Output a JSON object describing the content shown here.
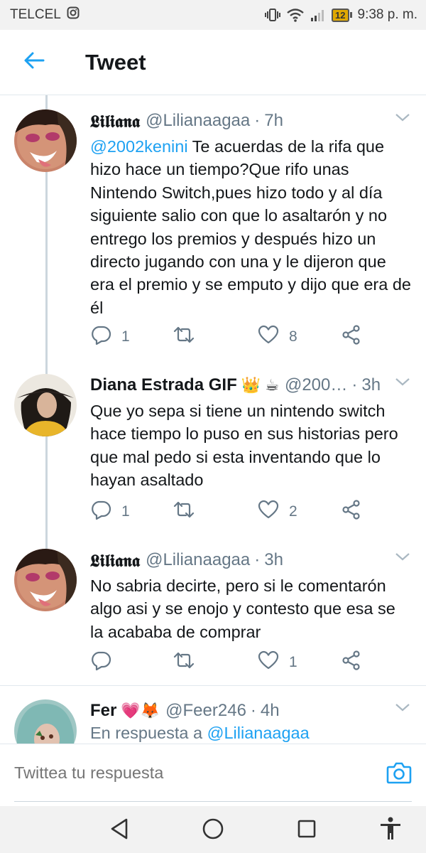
{
  "status_bar": {
    "carrier": "TELCEL",
    "battery": "12",
    "time": "9:38 p. m."
  },
  "header": {
    "title": "Tweet"
  },
  "tweets": [
    {
      "name": "𝕷𝖎𝖑𝖎𝖆𝖓𝖆",
      "handle": "@Lilianaagaa",
      "separator": "·",
      "time": "7h",
      "mention": "@2002kenini",
      "text": " Te acuerdas de la rifa que hizo hace un tiempo?Que rifo unas Nintendo Switch,pues hizo todo y al día siguiente salio con que lo asaltarón y no entrego los premios y después hizo un directo jugando con una y le dijeron que era el premio y se emputo y dijo que era de él",
      "replies": "1",
      "retweets": "",
      "likes": "8"
    },
    {
      "name": "Diana Estrada GIF",
      "emoji": "👑 ☕",
      "handle": "@200…",
      "separator": "·",
      "time": "3h",
      "text": "Que yo sepa si tiene un nintendo switch hace tiempo lo puso en sus historias pero que mal pedo si esta inventando que lo hayan asaltado",
      "replies": "1",
      "retweets": "",
      "likes": "2"
    },
    {
      "name": "𝕷𝖎𝖑𝖎𝖆𝖓𝖆",
      "handle": "@Lilianaagaa",
      "separator": "·",
      "time": "3h",
      "text": "No sabria decirte, pero si le comentarón algo asi y se enojo y contesto que esa se la acababa de comprar",
      "replies": "",
      "retweets": "",
      "likes": "1"
    },
    {
      "name": "Fer",
      "emoji": "💗🦊",
      "handle": "@Feer246",
      "separator": "·",
      "time": "4h",
      "reply_prefix": "En respuesta a ",
      "reply_to": "@Lilianaagaa"
    }
  ],
  "reply_bar": {
    "placeholder": "Twittea tu respuesta"
  },
  "icons": {
    "back": "arrow-left-icon",
    "caret": "chevron-down-icon",
    "reply": "reply-icon",
    "retweet": "retweet-icon",
    "like": "heart-icon",
    "share": "share-icon",
    "camera": "camera-icon"
  },
  "colors": {
    "accent": "#1da1f2",
    "muted": "#657786",
    "text": "#14171a",
    "divider": "#e1e8ed"
  }
}
